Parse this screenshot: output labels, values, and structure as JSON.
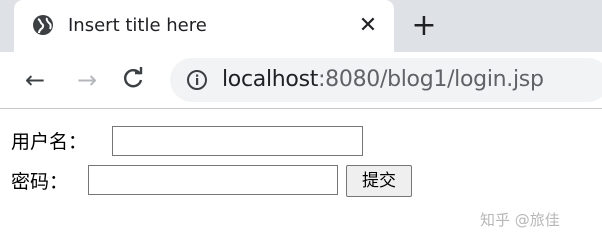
{
  "browser": {
    "tab": {
      "title": "Insert title here",
      "favicon": "globe-icon",
      "close_glyph": "✕"
    },
    "new_tab_glyph": "+",
    "nav": {
      "back_glyph": "←",
      "forward_glyph": "→",
      "reload_glyph": "C"
    },
    "address": {
      "host": "localhost",
      "rest": ":8080/blog1/login.jsp",
      "site_info_icon": "info-icon"
    },
    "colors": {
      "tabstrip": "#dee1e6",
      "omnibox": "#f1f3f4"
    }
  },
  "form": {
    "username_label": "用户名：",
    "username_value": "",
    "password_label": "密码：",
    "password_value": "",
    "submit_label": "提交"
  },
  "watermark": "知乎 @旅佳"
}
